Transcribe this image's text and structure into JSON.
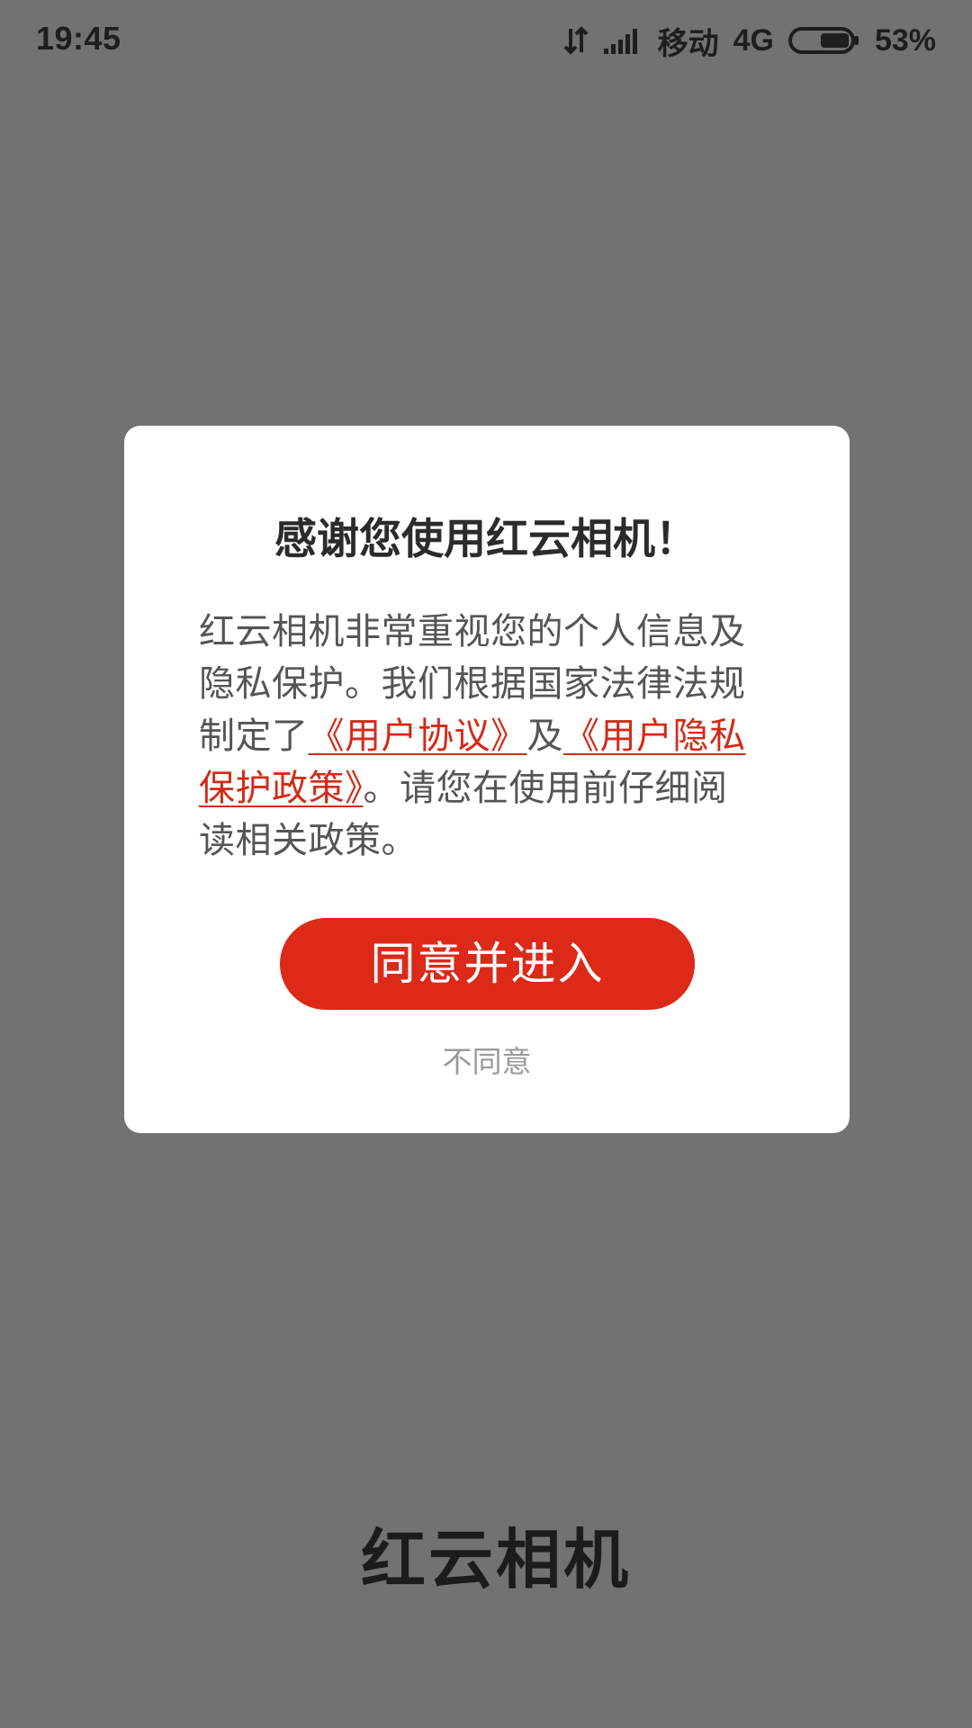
{
  "status_bar": {
    "time": "19:45",
    "carrier": "移动",
    "network": "4G",
    "battery_percent": "53%",
    "icons": [
      "data-transfer-icon",
      "signal-icon",
      "battery-icon"
    ]
  },
  "dialog": {
    "title": "感谢您使用红云相机！",
    "body_part1": "红云相机非常重视您的个人信息及隐私保护。我们根据国家法律法规制定了",
    "link_user_agreement": "《用户协议》",
    "body_and": "及",
    "link_privacy_policy": "《用户隐私保护政策》",
    "body_part2": "。请您在使用前仔细阅读相关政策。",
    "agree_label": "同意并进入",
    "disagree_label": "不同意",
    "colors": {
      "accent": "#dd2918",
      "link": "#d42a17",
      "overlay": "#727272"
    }
  },
  "background": {
    "app_name": "红云相机"
  }
}
